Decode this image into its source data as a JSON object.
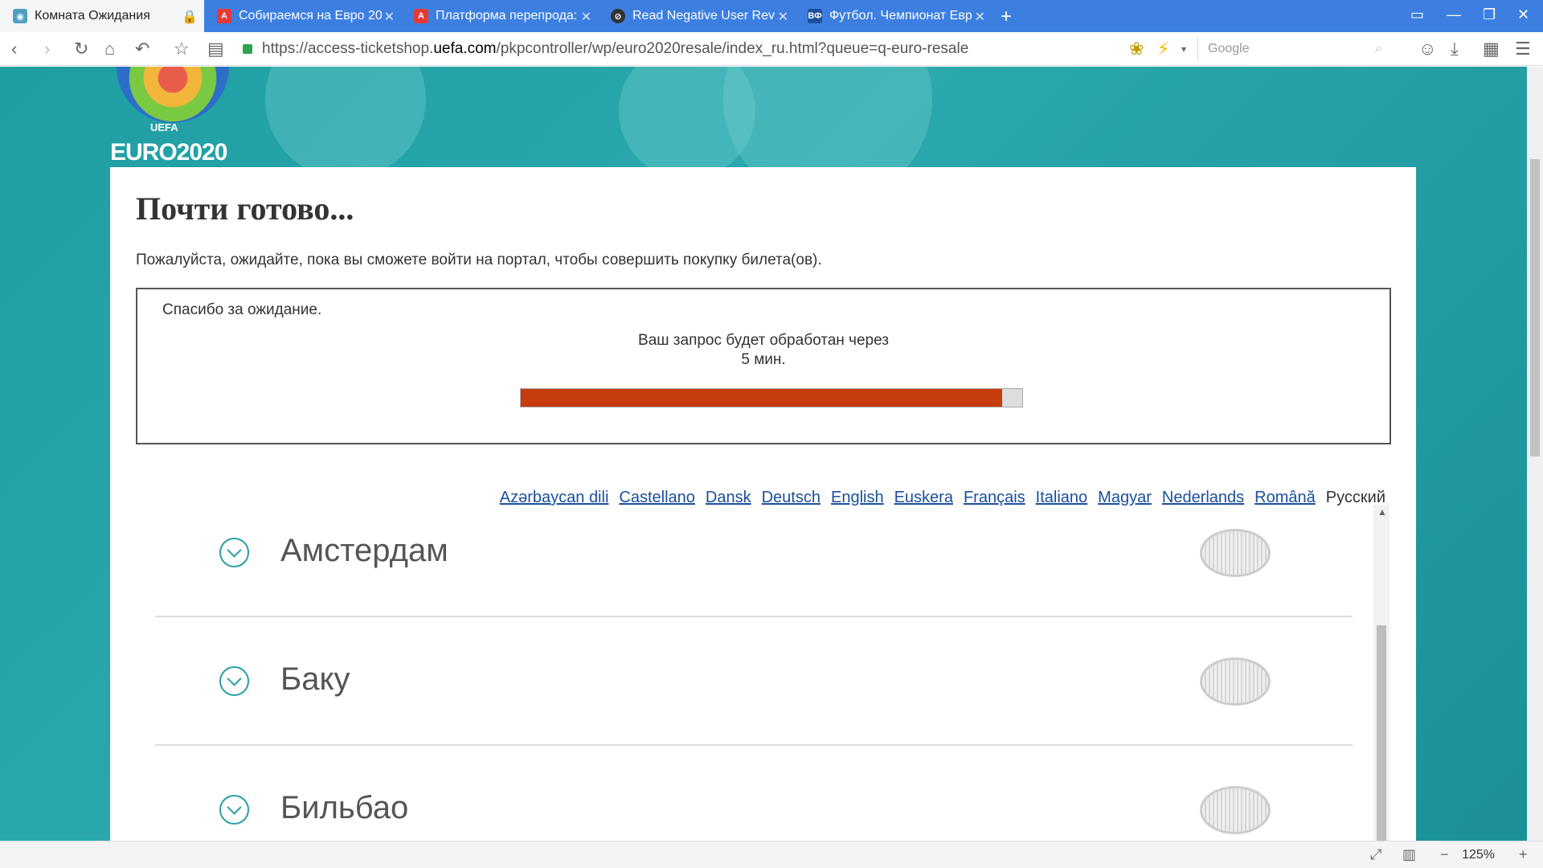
{
  "browser": {
    "tabs": [
      {
        "title": "Комната Ожидания",
        "favicon": "uefa-icon",
        "active": true
      },
      {
        "title": "Собираемся на Евро 20",
        "favicon": "a-icon"
      },
      {
        "title": "Платформа перепрода:",
        "favicon": "a-icon"
      },
      {
        "title": "Read Negative User Rev",
        "favicon": "ball-icon"
      },
      {
        "title": "Футбол. Чемпионат Евр",
        "favicon": "bf-icon"
      }
    ],
    "url_prefix": "https://access-ticketshop.",
    "url_domain": "uefa.com",
    "url_suffix": "/pkpcontroller/wp/euro2020resale/index_ru.html?queue=q-euro-resale",
    "search_placeholder": "Google",
    "zoom": "125%"
  },
  "logo": {
    "line1": "UEFA",
    "line2": "EURO2020"
  },
  "page": {
    "heading": "Почти готово...",
    "lead": "Пожалуйста, ожидайте, пока вы сможете войти на портал, чтобы совершить покупку билета(ов).",
    "thanks": "Спасибо за ожидание.",
    "msg_line1": "Ваш запрос будет обработан через",
    "msg_line2": "5 мин.",
    "progress_fraction": 0.96
  },
  "languages": [
    "Azərbaycan dili",
    "Castellano",
    "Dansk",
    "Deutsch",
    "English",
    "Euskera",
    "Français",
    "Italiano",
    "Magyar",
    "Nederlands",
    "Română"
  ],
  "current_language": "Русский",
  "cities": [
    "Амстердам",
    "Баку",
    "Бильбао"
  ],
  "colors": {
    "progress": "#c63c0c",
    "accent": "#2a9fa6",
    "link": "#1a4f9c"
  }
}
